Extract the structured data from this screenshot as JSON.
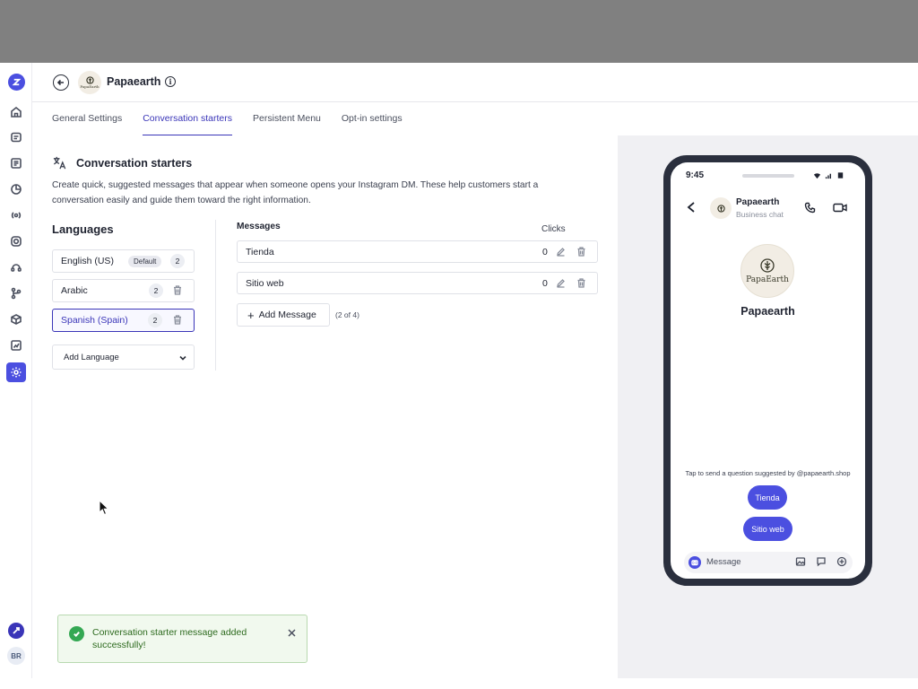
{
  "header": {
    "brand_name": "Papaearth",
    "avatar_mini_text": "PapaEarth"
  },
  "tabs": [
    {
      "label": "General Settings",
      "active": false
    },
    {
      "label": "Conversation starters",
      "active": true
    },
    {
      "label": "Persistent Menu",
      "active": false
    },
    {
      "label": "Opt-in settings",
      "active": false
    }
  ],
  "section": {
    "title": "Conversation starters",
    "description": "Create quick, suggested messages that appear when someone opens your Instagram DM. These help customers start a conversation easily and guide them toward the right information."
  },
  "languages": {
    "title": "Languages",
    "items": [
      {
        "name": "English (US)",
        "badge": "Default",
        "count": "2",
        "selected": false
      },
      {
        "name": "Arabic",
        "count": "2",
        "selected": false
      },
      {
        "name": "Spanish (Spain)",
        "count": "2",
        "selected": true
      }
    ],
    "add_label": "Add Language"
  },
  "messages": {
    "header": "Messages",
    "clicks_header": "Clicks",
    "rows": [
      {
        "text": "Tienda",
        "clicks": "0"
      },
      {
        "text": "Sitio web",
        "clicks": "0"
      }
    ],
    "add_label": "Add Message",
    "count_label": "(2 of 4)"
  },
  "preview": {
    "time": "9:45",
    "chat_name": "Papaearth",
    "chat_sub": "Business chat",
    "profile_logo_text": "PapaEarth",
    "profile_name": "Papaearth",
    "tap_text": "Tap to send a question suggested by @papaearth.shop",
    "pills": [
      "Tienda",
      "Sitio web"
    ],
    "message_placeholder": "Message"
  },
  "sidebar": {
    "avatar_initials": "BR"
  },
  "toast": {
    "message": "Conversation starter message added successfully!"
  },
  "colors": {
    "accent": "#4b4fe0",
    "active_tab": "#3a35b8",
    "toast_bg": "#f1f9ee",
    "toast_text": "#2d6a1e"
  }
}
